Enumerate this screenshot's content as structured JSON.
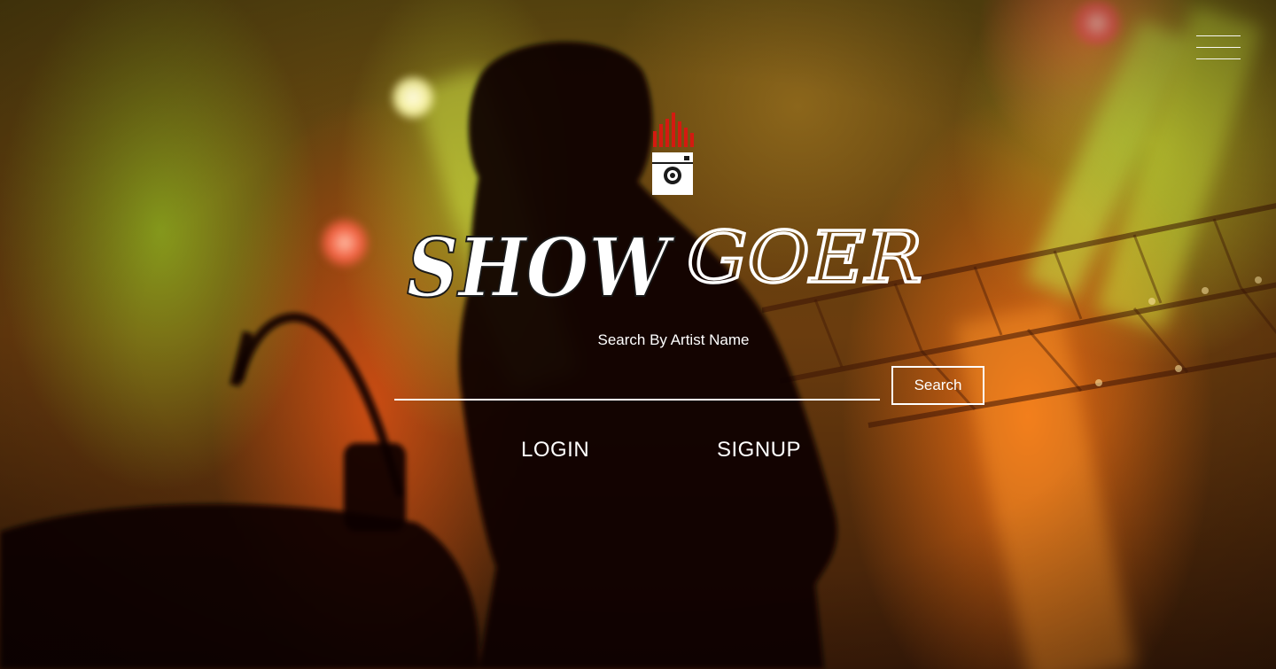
{
  "brand": {
    "name_part_1": "SHOW",
    "name_part_2": "GOER",
    "accent_color": "#d41a10"
  },
  "menu": {
    "icon": "hamburger-menu-icon"
  },
  "search": {
    "label": "Search By Artist Name",
    "value": "",
    "placeholder": "",
    "button_label": "Search"
  },
  "auth": {
    "login_label": "LOGIN",
    "signup_label": "SIGNUP"
  }
}
